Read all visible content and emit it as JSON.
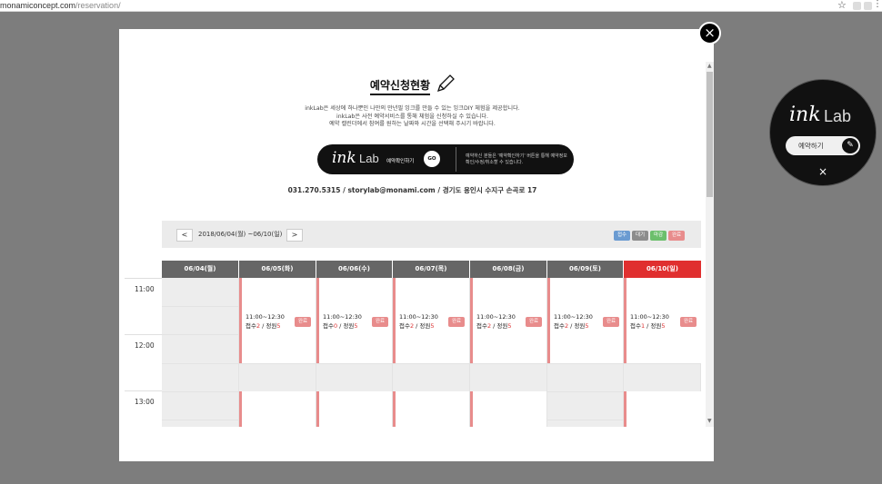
{
  "browser": {
    "url_host": "monamiconcept.com",
    "url_path": "/reservation/",
    "star_icon": "star-icon"
  },
  "modal": {
    "close_label": "×",
    "title": "예약신청현황",
    "intro_lines": [
      "inkLab은 세상에 하나뿐인 나만의 만년필 잉크를 만들 수 있는 잉크DIY 체험을 제공합니다.",
      "inkLab은 사전 예약서비스를 통해 체험을 신청하실 수 있습니다.",
      "예약 캘린더에서 참여를 원하는 날짜와 시간을 선택해 주시기 바랍니다."
    ],
    "banner": {
      "logo_ink": "ink",
      "logo_lab": "Lab",
      "label": "예약확인하기",
      "go": "GO",
      "note": "예약하신 분들은 '예약확인하기' 버튼을 통해 예약정보 확인/수정/취소할 수 있습니다."
    },
    "contact": "031.270.5315 / storylab@monami.com / 경기도 용인시 수지구 손곡로 17"
  },
  "calendar": {
    "prev_label": "<",
    "next_label": ">",
    "range": "2018/06/04(월) ~06/10(일)",
    "legend": [
      {
        "label": "접수",
        "color": "#6a9bd1"
      },
      {
        "label": "대기",
        "color": "#8c8c8c"
      },
      {
        "label": "마감",
        "color": "#6cbf6c"
      },
      {
        "label": "완료",
        "color": "#e88c8c"
      }
    ],
    "days": [
      "06/04(월)",
      "06/05(화)",
      "06/06(수)",
      "06/07(목)",
      "06/08(금)",
      "06/09(토)",
      "06/10(일)"
    ],
    "times": [
      "11:00",
      "12:00",
      "13:00"
    ],
    "slots": [
      {
        "time": "11:00~12:30",
        "applied_label": "접수",
        "applied": "2",
        "capacity_label": " / 정원",
        "capacity": "5",
        "status": "완료"
      },
      {
        "time": "11:00~12:30",
        "applied_label": "접수",
        "applied": "0",
        "capacity_label": " / 정원",
        "capacity": "5",
        "status": "완료"
      },
      {
        "time": "11:00~12:30",
        "applied_label": "접수",
        "applied": "2",
        "capacity_label": " / 정원",
        "capacity": "5",
        "status": "완료"
      },
      {
        "time": "11:00~12:30",
        "applied_label": "접수",
        "applied": "2",
        "capacity_label": " / 정원",
        "capacity": "5",
        "status": "완료"
      },
      {
        "time": "11:00~12:30",
        "applied_label": "접수",
        "applied": "2",
        "capacity_label": " / 정원",
        "capacity": "5",
        "status": "완료"
      },
      {
        "time": "11:00~12:30",
        "applied_label": "접수",
        "applied": "1",
        "capacity_label": " / 정원",
        "capacity": "5",
        "status": "완료"
      }
    ]
  },
  "widget": {
    "logo_ink": "ink",
    "logo_lab": "Lab",
    "button_label": "예약하기",
    "edit_icon": "pencil-icon",
    "close_label": "×"
  },
  "colors": {
    "accent_red": "#e02f2f",
    "header_gray": "#666666",
    "status_pink": "#e88c8c"
  }
}
